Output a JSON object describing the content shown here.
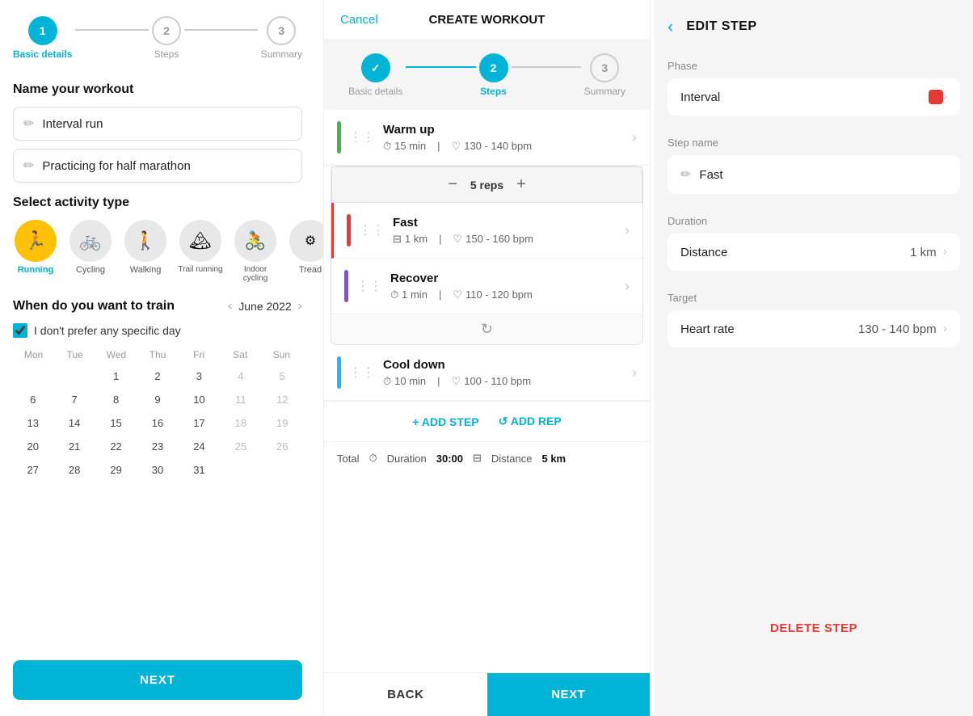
{
  "left": {
    "stepper": [
      {
        "num": "1",
        "label": "Basic details",
        "state": "active"
      },
      {
        "num": "2",
        "label": "Steps",
        "state": "inactive"
      },
      {
        "num": "3",
        "label": "Summary",
        "state": "inactive"
      }
    ],
    "name_section_title": "Name your workout",
    "workout_name": "Interval run",
    "workout_desc": "Practicing for half marathon",
    "activity_title": "Select activity type",
    "activities": [
      {
        "icon": "🏃",
        "label": "Running",
        "selected": true
      },
      {
        "icon": "🚲",
        "label": "Cycling",
        "selected": false
      },
      {
        "icon": "🚶",
        "label": "Walking",
        "selected": false
      },
      {
        "icon": "🏔",
        "label": "Trail running",
        "selected": false
      },
      {
        "icon": "🚴",
        "label": "Indoor cycling",
        "selected": false
      },
      {
        "icon": "🏃",
        "label": "Tread",
        "selected": false
      }
    ],
    "train_title": "When do you want to train",
    "month": "June 2022",
    "no_pref_label": "I don't prefer any specific day",
    "calendar_days": [
      "Mon",
      "Tue",
      "Wed",
      "Thu",
      "Fri",
      "Sat",
      "Sun"
    ],
    "calendar_weeks": [
      [
        "",
        "",
        "1",
        "2",
        "3",
        "4",
        "5"
      ],
      [
        "6",
        "7",
        "8",
        "9",
        "10",
        "11",
        "12"
      ],
      [
        "13",
        "14",
        "15",
        "16",
        "17",
        "18",
        "19"
      ],
      [
        "20",
        "21",
        "22",
        "23",
        "24",
        "25",
        "26"
      ],
      [
        "27",
        "28",
        "29",
        "30",
        "31",
        "",
        ""
      ]
    ],
    "next_btn": "NEXT"
  },
  "middle": {
    "cancel_label": "Cancel",
    "title": "CREATE WORKOUT",
    "stepper": [
      {
        "num": "✓",
        "label": "Basic details",
        "state": "done"
      },
      {
        "num": "2",
        "label": "Steps",
        "state": "active"
      },
      {
        "num": "3",
        "label": "Summary",
        "state": "inactive"
      }
    ],
    "steps": [
      {
        "name": "Warm up",
        "color": "#4caf50",
        "duration": "15 min",
        "heart_rate": "130 - 140 bpm"
      }
    ],
    "reps_count": "5 reps",
    "interval_steps": [
      {
        "name": "Fast",
        "color": "#e53935",
        "distance": "1 km",
        "heart_rate": "150 - 160 bpm"
      },
      {
        "name": "Recover",
        "color": "#7e57c2",
        "duration": "1 min",
        "heart_rate": "110 - 120 bpm"
      }
    ],
    "cool_down": {
      "name": "Cool down",
      "color": "#29b6f6",
      "duration": "10 min",
      "heart_rate": "100 - 110 bpm"
    },
    "add_step_label": "+ ADD STEP",
    "add_rep_label": "↺ ADD REP",
    "total_label": "Total",
    "total_duration": "30:00",
    "total_distance": "5 km",
    "back_btn": "BACK",
    "next_btn": "NEXT"
  },
  "right": {
    "back_arrow": "‹",
    "title": "EDIT STEP",
    "phase_label": "Phase",
    "phase_value": "Interval",
    "step_name_label": "Step name",
    "step_name_value": "Fast",
    "duration_label": "Duration",
    "duration_type": "Distance",
    "duration_value": "1 km",
    "target_label": "Target",
    "target_type": "Heart rate",
    "target_value": "130 - 140 bpm",
    "delete_btn": "DELETE STEP"
  }
}
